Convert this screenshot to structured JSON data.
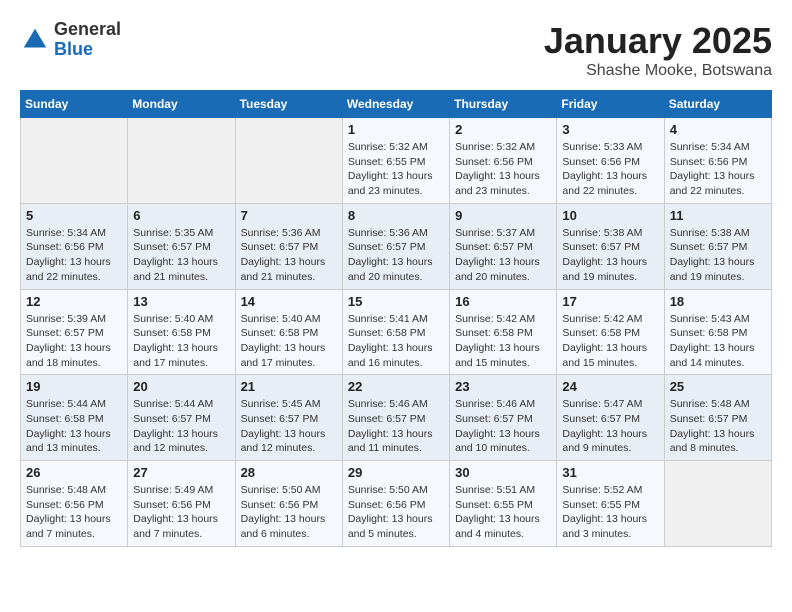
{
  "header": {
    "logo_general": "General",
    "logo_blue": "Blue",
    "title": "January 2025",
    "subtitle": "Shashe Mooke, Botswana"
  },
  "days_of_week": [
    "Sunday",
    "Monday",
    "Tuesday",
    "Wednesday",
    "Thursday",
    "Friday",
    "Saturday"
  ],
  "weeks": [
    [
      {
        "day": "",
        "info": ""
      },
      {
        "day": "",
        "info": ""
      },
      {
        "day": "",
        "info": ""
      },
      {
        "day": "1",
        "info": "Sunrise: 5:32 AM\nSunset: 6:55 PM\nDaylight: 13 hours and 23 minutes."
      },
      {
        "day": "2",
        "info": "Sunrise: 5:32 AM\nSunset: 6:56 PM\nDaylight: 13 hours and 23 minutes."
      },
      {
        "day": "3",
        "info": "Sunrise: 5:33 AM\nSunset: 6:56 PM\nDaylight: 13 hours and 22 minutes."
      },
      {
        "day": "4",
        "info": "Sunrise: 5:34 AM\nSunset: 6:56 PM\nDaylight: 13 hours and 22 minutes."
      }
    ],
    [
      {
        "day": "5",
        "info": "Sunrise: 5:34 AM\nSunset: 6:56 PM\nDaylight: 13 hours and 22 minutes."
      },
      {
        "day": "6",
        "info": "Sunrise: 5:35 AM\nSunset: 6:57 PM\nDaylight: 13 hours and 21 minutes."
      },
      {
        "day": "7",
        "info": "Sunrise: 5:36 AM\nSunset: 6:57 PM\nDaylight: 13 hours and 21 minutes."
      },
      {
        "day": "8",
        "info": "Sunrise: 5:36 AM\nSunset: 6:57 PM\nDaylight: 13 hours and 20 minutes."
      },
      {
        "day": "9",
        "info": "Sunrise: 5:37 AM\nSunset: 6:57 PM\nDaylight: 13 hours and 20 minutes."
      },
      {
        "day": "10",
        "info": "Sunrise: 5:38 AM\nSunset: 6:57 PM\nDaylight: 13 hours and 19 minutes."
      },
      {
        "day": "11",
        "info": "Sunrise: 5:38 AM\nSunset: 6:57 PM\nDaylight: 13 hours and 19 minutes."
      }
    ],
    [
      {
        "day": "12",
        "info": "Sunrise: 5:39 AM\nSunset: 6:57 PM\nDaylight: 13 hours and 18 minutes."
      },
      {
        "day": "13",
        "info": "Sunrise: 5:40 AM\nSunset: 6:58 PM\nDaylight: 13 hours and 17 minutes."
      },
      {
        "day": "14",
        "info": "Sunrise: 5:40 AM\nSunset: 6:58 PM\nDaylight: 13 hours and 17 minutes."
      },
      {
        "day": "15",
        "info": "Sunrise: 5:41 AM\nSunset: 6:58 PM\nDaylight: 13 hours and 16 minutes."
      },
      {
        "day": "16",
        "info": "Sunrise: 5:42 AM\nSunset: 6:58 PM\nDaylight: 13 hours and 15 minutes."
      },
      {
        "day": "17",
        "info": "Sunrise: 5:42 AM\nSunset: 6:58 PM\nDaylight: 13 hours and 15 minutes."
      },
      {
        "day": "18",
        "info": "Sunrise: 5:43 AM\nSunset: 6:58 PM\nDaylight: 13 hours and 14 minutes."
      }
    ],
    [
      {
        "day": "19",
        "info": "Sunrise: 5:44 AM\nSunset: 6:58 PM\nDaylight: 13 hours and 13 minutes."
      },
      {
        "day": "20",
        "info": "Sunrise: 5:44 AM\nSunset: 6:57 PM\nDaylight: 13 hours and 12 minutes."
      },
      {
        "day": "21",
        "info": "Sunrise: 5:45 AM\nSunset: 6:57 PM\nDaylight: 13 hours and 12 minutes."
      },
      {
        "day": "22",
        "info": "Sunrise: 5:46 AM\nSunset: 6:57 PM\nDaylight: 13 hours and 11 minutes."
      },
      {
        "day": "23",
        "info": "Sunrise: 5:46 AM\nSunset: 6:57 PM\nDaylight: 13 hours and 10 minutes."
      },
      {
        "day": "24",
        "info": "Sunrise: 5:47 AM\nSunset: 6:57 PM\nDaylight: 13 hours and 9 minutes."
      },
      {
        "day": "25",
        "info": "Sunrise: 5:48 AM\nSunset: 6:57 PM\nDaylight: 13 hours and 8 minutes."
      }
    ],
    [
      {
        "day": "26",
        "info": "Sunrise: 5:48 AM\nSunset: 6:56 PM\nDaylight: 13 hours and 7 minutes."
      },
      {
        "day": "27",
        "info": "Sunrise: 5:49 AM\nSunset: 6:56 PM\nDaylight: 13 hours and 7 minutes."
      },
      {
        "day": "28",
        "info": "Sunrise: 5:50 AM\nSunset: 6:56 PM\nDaylight: 13 hours and 6 minutes."
      },
      {
        "day": "29",
        "info": "Sunrise: 5:50 AM\nSunset: 6:56 PM\nDaylight: 13 hours and 5 minutes."
      },
      {
        "day": "30",
        "info": "Sunrise: 5:51 AM\nSunset: 6:55 PM\nDaylight: 13 hours and 4 minutes."
      },
      {
        "day": "31",
        "info": "Sunrise: 5:52 AM\nSunset: 6:55 PM\nDaylight: 13 hours and 3 minutes."
      },
      {
        "day": "",
        "info": ""
      }
    ]
  ]
}
